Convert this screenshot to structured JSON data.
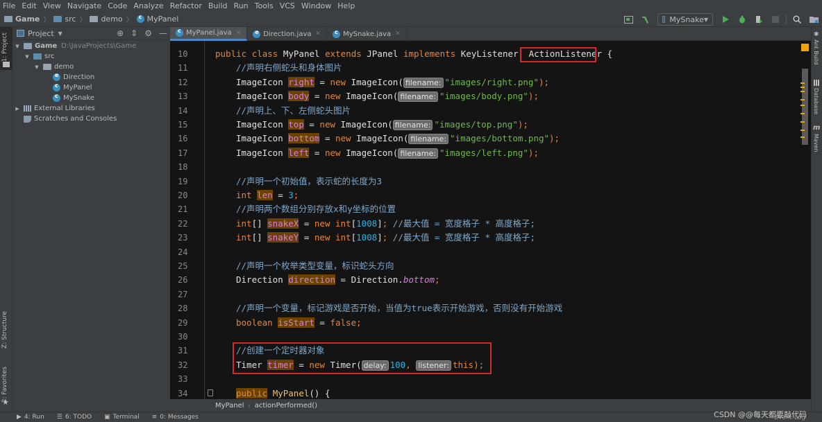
{
  "menu": [
    "File",
    "Edit",
    "View",
    "Navigate",
    "Code",
    "Analyze",
    "Refactor",
    "Build",
    "Run",
    "Tools",
    "VCS",
    "Window",
    "Help"
  ],
  "navbar": {
    "crumbs": [
      "Game",
      "src",
      "demo",
      "MyPanel"
    ]
  },
  "toolbar": {
    "run_config": "MySnake"
  },
  "left_strip": {
    "project_tab": "1: Project",
    "structure_tab": "Z: Structure",
    "favorites_tab": "2: Favorites"
  },
  "right_strip": {
    "ant": "Ant Build",
    "database": "Database",
    "maven": "Maven"
  },
  "project_panel": {
    "title": "Project",
    "tree": [
      {
        "label": "Game",
        "path": "D:\\JavaProjects\\Game",
        "level": 0
      },
      {
        "label": "src",
        "level": 1
      },
      {
        "label": "demo",
        "level": 2
      },
      {
        "label": "Direction",
        "level": 3
      },
      {
        "label": "MyPanel",
        "level": 3
      },
      {
        "label": "MySnake",
        "level": 3
      },
      {
        "label": "External Libraries",
        "level": 0
      },
      {
        "label": "Scratches and Consoles",
        "level": 0
      }
    ]
  },
  "tabs": [
    {
      "label": "MyPanel.java",
      "active": true
    },
    {
      "label": "Direction.java",
      "active": false
    },
    {
      "label": "MySnake.java",
      "active": false
    }
  ],
  "editor": {
    "line_numbers": [
      "10",
      "11",
      "12",
      "13",
      "14",
      "15",
      "16",
      "17",
      "18",
      "19",
      "20",
      "21",
      "22",
      "23",
      "24",
      "25",
      "26",
      "27",
      "28",
      "29",
      "30",
      "31",
      "32",
      "33",
      "34"
    ],
    "l10": {
      "a": "public class ",
      "b": "MyPanel ",
      "c": "extends ",
      "d": "JPanel ",
      "e": "implements ",
      "f": "KeyListener",
      ",": ", ",
      "g": "ActionListener",
      "h": " {"
    },
    "l11": "//声明右侧蛇头和身体图片",
    "l12": {
      "type": "ImageIcon ",
      "var": "right",
      "eq": " = ",
      "new": "new ",
      "cls": "ImageIcon(",
      "hint": "filename:",
      "str": "\"images/right.png\"",
      "end": ");"
    },
    "l13": {
      "type": "ImageIcon ",
      "var": "body",
      "eq": " = ",
      "new": "new ",
      "cls": "ImageIcon(",
      "hint": "filename:",
      "str": "\"images/body.png\"",
      "end": ");"
    },
    "l14": "//声明上、下、左侧蛇头图片",
    "l15": {
      "type": "ImageIcon ",
      "var": "top",
      "eq": " = ",
      "new": "new ",
      "cls": "ImageIcon(",
      "hint": "filename:",
      "str": "\"images/top.png\"",
      "end": ");"
    },
    "l16": {
      "type": "ImageIcon ",
      "var": "bottom",
      "eq": " = ",
      "new": "new ",
      "cls": "ImageIcon(",
      "hint": "filename:",
      "str": "\"images/bottom.png\"",
      "end": ");"
    },
    "l17": {
      "type": "ImageIcon ",
      "var": "left",
      "eq": " = ",
      "new": "new ",
      "cls": "ImageIcon(",
      "hint": "filename:",
      "str": "\"images/left.png\"",
      "end": ");"
    },
    "l19": "//声明一个初始值，表示蛇的长度为3",
    "l20": {
      "type": "int ",
      "var": "len",
      "eq": " = ",
      "num": "3",
      "end": ";"
    },
    "l21": "//声明两个数组分别存放x和y坐标的位置",
    "l22": {
      "type": "int",
      "br": "[] ",
      "var": "snakeX",
      "eq": " = ",
      "new": "new ",
      "t2": "int",
      "o": "[",
      "num": "1008",
      "c": "]",
      "semi": ";",
      "cm": " //最大值 = 宽度格子 * 高度格子;"
    },
    "l23": {
      "type": "int",
      "br": "[] ",
      "var": "snakeY",
      "eq": " = ",
      "new": "new ",
      "t2": "int",
      "o": "[",
      "num": "1008",
      "c": "]",
      "semi": ";",
      "cm": " //最大值 = 宽度格子 * 高度格子;"
    },
    "l25": "//声明一个枚举类型变量，标识蛇头方向",
    "l26": {
      "type": "Direction ",
      "var": "direction",
      "eq": " = ",
      "cls": "Direction.",
      "it": "bottom",
      "end": ";"
    },
    "l28": "//声明一个变量，标记游戏是否开始，当值为true表示开始游戏，否则没有开始游戏",
    "l29": {
      "type": "boolean ",
      "var": "isStart",
      "eq": " = ",
      "val": "false",
      "end": ";"
    },
    "l31": "//创建一个定时器对象",
    "l32": {
      "type": "Timer ",
      "var": "timer",
      "eq": " = ",
      "new": "new ",
      "cls": "Timer(",
      "hint1": "delay:",
      "num": "100",
      "comma": ", ",
      "hint2": "listener:",
      "this": "this",
      "end": ");"
    },
    "l34": {
      "kw": "public",
      "sp": " ",
      "fn": "MyPanel",
      "end": "() {"
    }
  },
  "editor_breadcrumb": [
    "MyPanel",
    "actionPerformed()"
  ],
  "statusbar": [
    {
      "label": "4: Run"
    },
    {
      "label": "6: TODO"
    },
    {
      "label": "Terminal"
    },
    {
      "label": "0: Messages"
    }
  ],
  "watermark": "CSDN @@每天都要敲代码",
  "event_log": "Event Log"
}
